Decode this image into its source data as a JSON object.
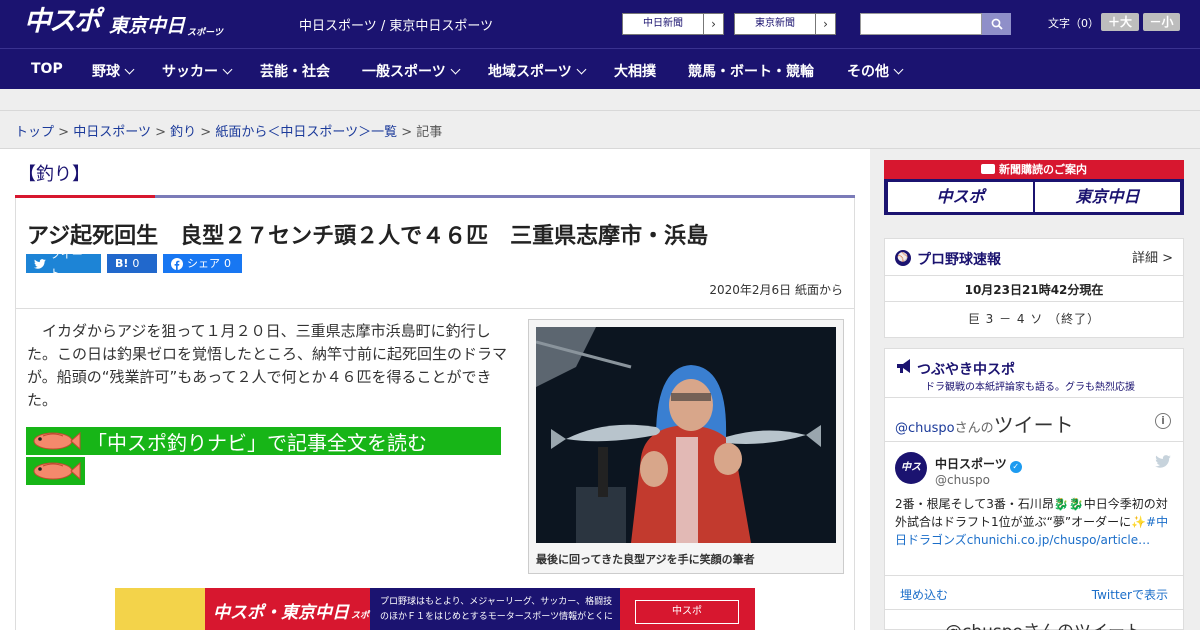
{
  "header": {
    "logo_chuspo": "中スポ",
    "logo_tokyo": "東京中日",
    "logo_sports": "スポーツ",
    "site_title": "中日スポーツ / 東京中日スポーツ",
    "paper_buttons": [
      {
        "label": "中日新聞",
        "arrow": "›"
      },
      {
        "label": "東京新聞",
        "arrow": "›"
      }
    ],
    "search_placeholder": "",
    "font_label": "文字（0）",
    "font_bigger": "＋大",
    "font_smaller": "－小"
  },
  "nav": {
    "items": [
      {
        "label": "TOP",
        "dropdown": false
      },
      {
        "label": "野球",
        "dropdown": true
      },
      {
        "label": "サッカー",
        "dropdown": true
      },
      {
        "label": "芸能・社会",
        "dropdown": false
      },
      {
        "label": "一般スポーツ",
        "dropdown": true
      },
      {
        "label": "地域スポーツ",
        "dropdown": true
      },
      {
        "label": "大相撲",
        "dropdown": false
      },
      {
        "label": "競馬・ボート・競輪",
        "dropdown": false
      },
      {
        "label": "その他",
        "dropdown": true
      }
    ]
  },
  "breadcrumb": {
    "items": [
      "トップ",
      "中日スポーツ",
      "釣り",
      "紙面から＜中日スポーツ＞一覧"
    ],
    "separator": ">",
    "current": "記事"
  },
  "article": {
    "section": "【釣り】",
    "headline": "アジ起死回生　良型２７センチ頭２人で４６匹　三重県志摩市・浜島",
    "share": {
      "tweet": "ツイート",
      "hatena": "B!",
      "hatena_count": "0",
      "facebook": "シェア",
      "facebook_count": "0"
    },
    "date": "2020年2月6日 紙面から",
    "lead": "イカダからアジを狙って１月２０日、三重県志摩市浜島町に釣行した。この日は釣果ゼロを覚悟したところ、納竿寸前に起死回生のドラマが。船頭の“残業許可”もあって２人で何とか４６匹を得ることができた。",
    "navi_link": "「中スポ釣りナビ」で記事全文を読む",
    "photo_caption": "最後に回ってきた良型アジを手に笑顔の筆者"
  },
  "ad": {
    "brand": "中スポ・東京中日",
    "brand_sub": "スポーツ",
    "desc_line1": "プロ野球はもとより、メジャーリーグ、サッカー、格闘技",
    "desc_line2": "のほかＦ１をはじめとするモータースポーツ情報がとくに",
    "button": "中スポ"
  },
  "sidebar": {
    "subscribe": {
      "title": "新聞購読のご案内",
      "btn1": "中スポ",
      "btn2": "東京中日"
    },
    "baseball": {
      "title": "プロ野球速報",
      "detail": "詳細 >",
      "time": "10月23日21時42分現在",
      "score": "巨 3 － 4 ソ （終了）"
    },
    "twitter": {
      "title": "つぶやき中スポ",
      "subtitle": "ドラ観戦の本紙評論家も語る。グラも熱烈応援",
      "handle_prefix": "@chuspo",
      "handle_suffix": "さんの",
      "tweets_word": "ツイート",
      "account_name": "中日スポーツ",
      "account_handle": "@chuspo",
      "tweet_text": "2番・根尾そして3番・石川昂🐉🐉中日今季初の対外試合はドラフト1位が並ぶ“夢”オーダーに✨",
      "tweet_link": "#中日ドラゴンズchunichi.co.jp/chuspo/article…",
      "embed": "埋め込む",
      "view_on": "Twitterで表示",
      "next_header": "@chuspoさんのツイート"
    }
  },
  "colors": {
    "brand_navy": "#1b1370",
    "accent_red": "#d7172f",
    "navi_green": "#17b517",
    "link_blue": "#1b3a9a"
  }
}
